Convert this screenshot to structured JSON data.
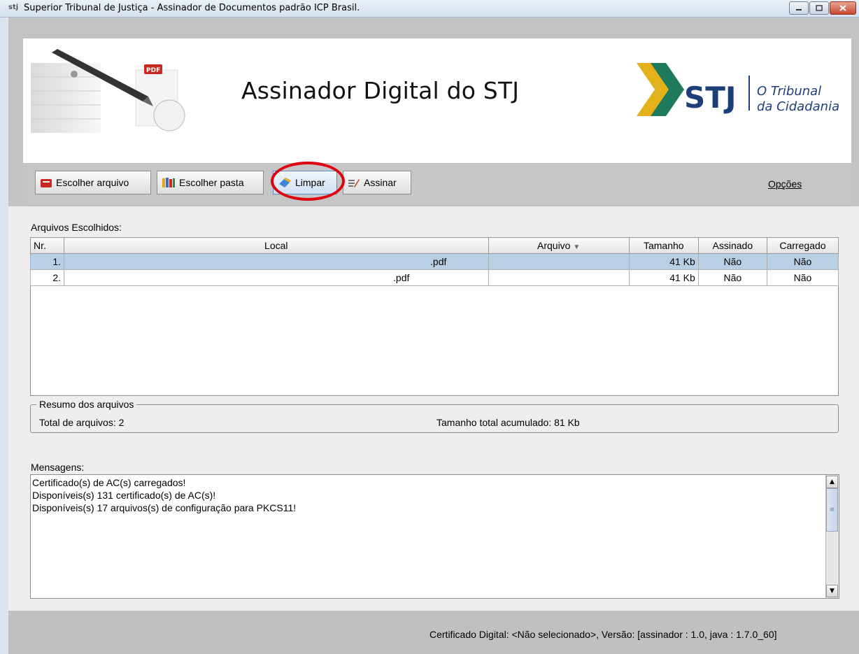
{
  "window": {
    "title": "Superior Tribunal de Justiça - Assinador de Documentos padrão ICP Brasil.",
    "icon_label": "stj"
  },
  "banner": {
    "title": "Assinador Digital do STJ",
    "logo_left_badge": "PDF",
    "stj_text": "STJ",
    "stj_slogan_line1": "O Tribunal",
    "stj_slogan_line2": "da Cidadania"
  },
  "toolbar": {
    "choose_file": "Escolher arquivo",
    "choose_folder": "Escolher pasta",
    "clear": "Limpar",
    "sign": "Assinar",
    "options": "Opções"
  },
  "files": {
    "label": "Arquivos Escolhidos:",
    "columns": [
      "Nr.",
      "Local",
      "Arquivo",
      "Tamanho",
      "Assinado",
      "Carregado"
    ],
    "rows": [
      {
        "nr": "1.",
        "local": ".pdf",
        "arquivo": "",
        "tamanho": "41 Kb",
        "assinado": "Não",
        "carregado": "Não"
      },
      {
        "nr": "2.",
        "local": ".pdf",
        "arquivo": "",
        "tamanho": "41 Kb",
        "assinado": "Não",
        "carregado": "Não"
      }
    ]
  },
  "summary": {
    "title": "Resumo dos arquivos",
    "total_files": "Total de arquivos: 2",
    "total_size": "Tamanho total acumulado: 81 Kb"
  },
  "messages": {
    "label": "Mensagens:",
    "lines": [
      "Certificado(s) de AC(s) carregados!",
      "Disponíveis(s) 131 certificado(s) de AC(s)!",
      "Disponíveis(s) 17 arquivos(s) de configuração para PKCS11!"
    ]
  },
  "status": {
    "text": "Certificado Digital: <Não selecionado>,  Versão: [assinador : 1.0, java : 1.7.0_60]"
  },
  "colors": {
    "highlight_circle": "#e00010",
    "selected_row": "#b8cfe5",
    "stj_green": "#1f7a5c",
    "stj_yellow": "#e3b21b",
    "stj_blue": "#1c3f7a"
  }
}
